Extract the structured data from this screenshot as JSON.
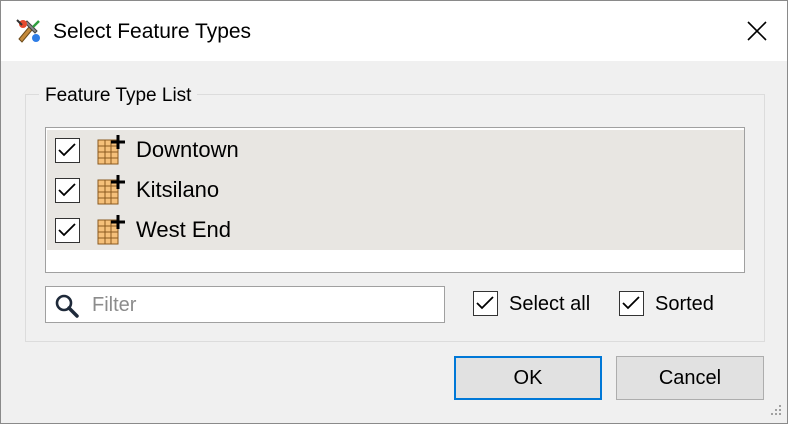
{
  "window": {
    "title": "Select Feature Types",
    "app_icon": "fme-workbench-icon",
    "close_icon": "close-icon"
  },
  "group": {
    "label": "Feature Type List"
  },
  "feature_types": [
    {
      "label": "Downtown",
      "checked": true,
      "icon": "feature-layer-add-icon"
    },
    {
      "label": "Kitsilano",
      "checked": true,
      "icon": "feature-layer-add-icon"
    },
    {
      "label": "West End",
      "checked": true,
      "icon": "feature-layer-add-icon"
    }
  ],
  "filter": {
    "placeholder": "Filter",
    "value": "",
    "icon": "search-icon"
  },
  "options": {
    "select_all_label": "Select all",
    "select_all_checked": true,
    "sorted_label": "Sorted",
    "sorted_checked": true
  },
  "buttons": {
    "ok_label": "OK",
    "cancel_label": "Cancel"
  },
  "colors": {
    "selected_row": "#e8e6e2",
    "default_button_border": "#0078d7",
    "layer_icon_fill": "#f5c07a"
  }
}
